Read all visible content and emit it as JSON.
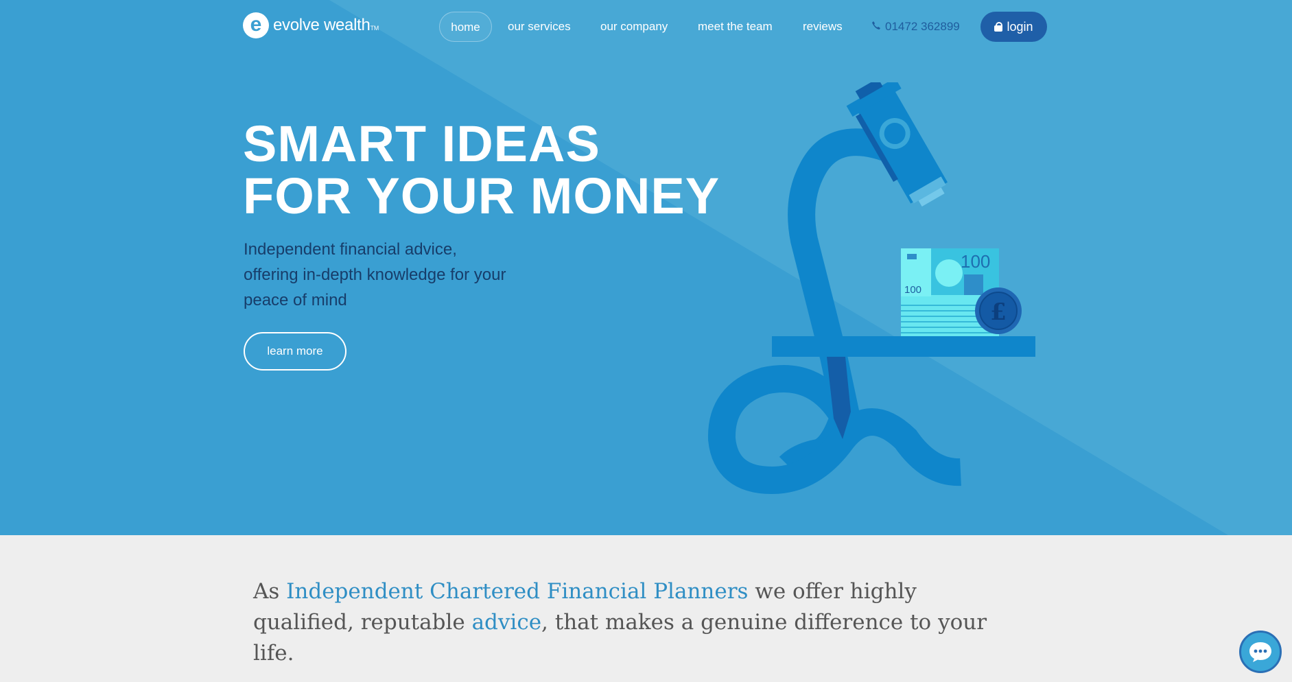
{
  "brand": {
    "logo_letter": "e",
    "name": "evolve wealth",
    "trademark": "TM"
  },
  "nav": {
    "items": [
      {
        "label": "home",
        "active": true
      },
      {
        "label": "our services"
      },
      {
        "label": "our company"
      },
      {
        "label": "meet the team"
      },
      {
        "label": "reviews"
      }
    ],
    "phone": "01472 362899",
    "phone_icon": "phone-icon",
    "login_label": "login",
    "login_icon": "lock-icon"
  },
  "hero": {
    "headline_line1": "SMART IDEAS",
    "headline_line2": "FOR YOUR MONEY",
    "sub_line1": "Independent financial advice,",
    "sub_line2": "offering in-depth knowledge for your",
    "sub_line3": "peace of mind",
    "cta_label": "learn more",
    "banknote_value": "100",
    "coin_symbol": "£"
  },
  "intro": {
    "part1": "As ",
    "link1": "Independent Chartered Financial Planners",
    "part2": " we offer highly qualified, reputable ",
    "link2": "advice",
    "part3": ", that makes a genuine difference to your life."
  },
  "chat": {
    "icon": "chat-bubble-icon"
  },
  "colors": {
    "hero_bg": "#3a9fd2",
    "accent_dark": "#1f5fa8",
    "link": "#2f8ec4",
    "section_bg": "#eeeeee"
  }
}
